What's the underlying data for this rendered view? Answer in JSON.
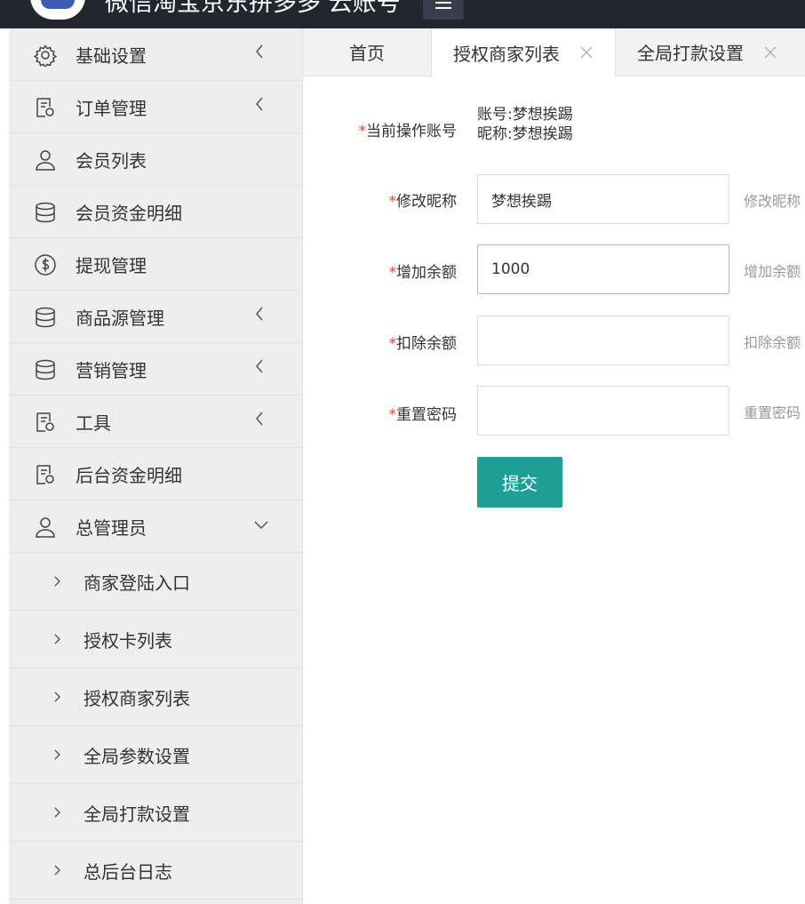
{
  "header": {
    "title": "微信淘宝京东拼多多 云账号"
  },
  "sidebar": {
    "items": [
      {
        "label": "基础设置",
        "icon": "gear-icon",
        "expandable": true
      },
      {
        "label": "订单管理",
        "icon": "document-icon",
        "expandable": true
      },
      {
        "label": "会员列表",
        "icon": "user-icon",
        "expandable": false
      },
      {
        "label": "会员资金明细",
        "icon": "database-icon",
        "expandable": false
      },
      {
        "label": "提现管理",
        "icon": "dollar-icon",
        "expandable": false
      },
      {
        "label": "商品源管理",
        "icon": "database-icon",
        "expandable": true
      },
      {
        "label": "营销管理",
        "icon": "database-icon",
        "expandable": true
      },
      {
        "label": "工具",
        "icon": "document-icon",
        "expandable": true
      },
      {
        "label": "后台资金明细",
        "icon": "document-icon",
        "expandable": false
      },
      {
        "label": "总管理员",
        "icon": "user-icon",
        "expanded": true
      }
    ],
    "subitems": [
      {
        "label": "商家登陆入口"
      },
      {
        "label": "授权卡列表"
      },
      {
        "label": "授权商家列表"
      },
      {
        "label": "全局参数设置"
      },
      {
        "label": "全局打款设置"
      },
      {
        "label": "总后台日志"
      }
    ]
  },
  "tabs": [
    {
      "label": "首页",
      "closable": false,
      "active": false
    },
    {
      "label": "授权商家列表",
      "closable": true,
      "active": true
    },
    {
      "label": "全局打款设置",
      "closable": true,
      "active": false
    }
  ],
  "form": {
    "required_mark": "*",
    "account_label": "当前操作账号",
    "account_line1": "账号:梦想挨踢",
    "account_line2": "昵称:梦想挨踢",
    "nickname_label": "修改昵称",
    "nickname_value": "梦想挨踢",
    "nickname_hint": "修改昵称",
    "add_label": "增加余额",
    "add_value": "1000",
    "add_hint": "增加余额",
    "deduct_label": "扣除余额",
    "deduct_value": "",
    "deduct_hint": "扣除余额",
    "password_label": "重置密码",
    "password_value": "",
    "password_hint": "重置密码",
    "submit_label": "提交"
  },
  "colors": {
    "header_bg": "#23262e",
    "sidebar_bg": "#eeeeee",
    "primary_button": "#1e9f95",
    "required": "#ff3b30"
  }
}
